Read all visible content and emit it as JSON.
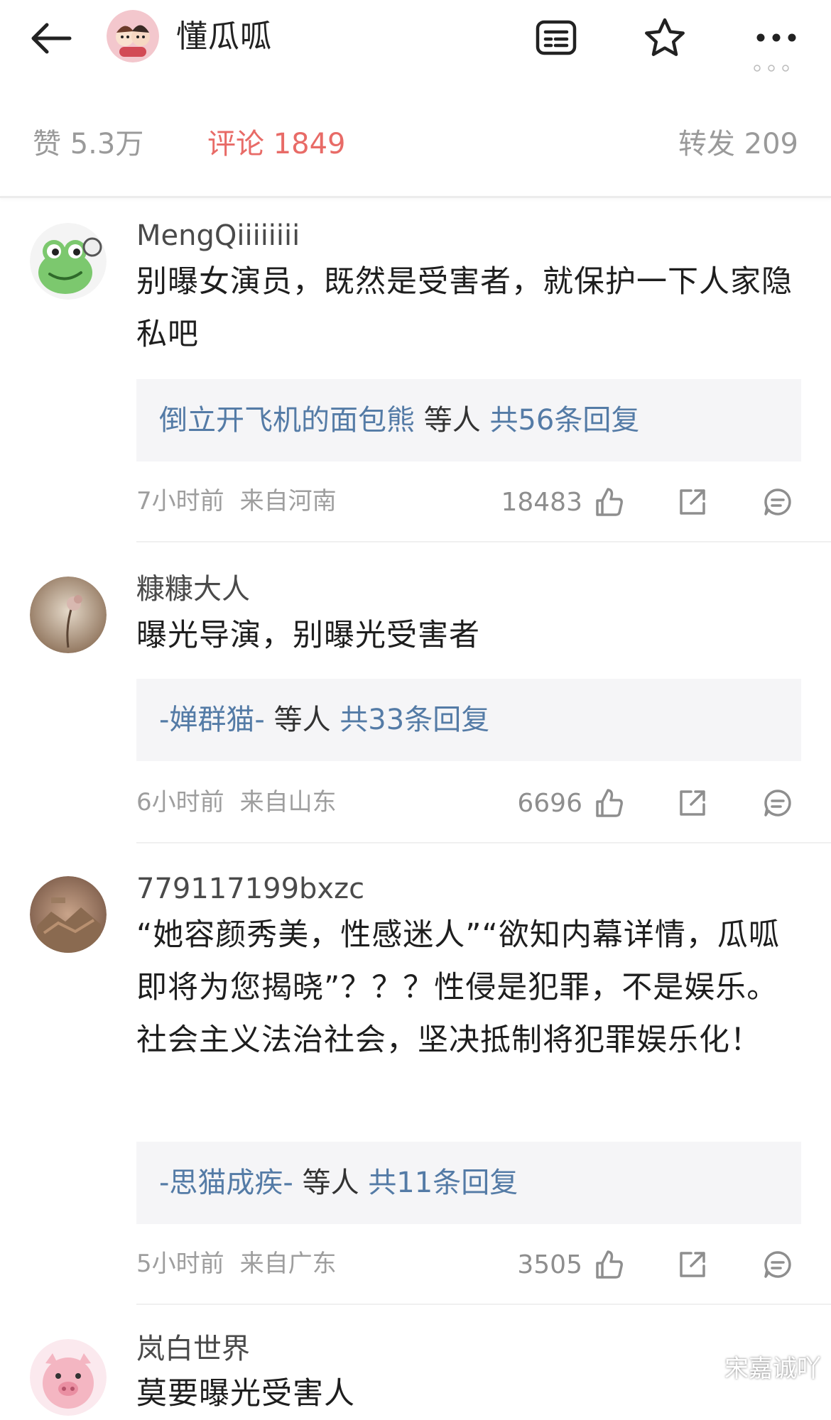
{
  "header": {
    "title": "懂瓜呱",
    "icons": [
      "back-arrow-icon",
      "article-icon",
      "star-icon",
      "more-icon"
    ]
  },
  "stats": {
    "likes": "赞 5.3万",
    "comments": "评论 1849",
    "reposts": "转发 209"
  },
  "colors": {
    "active_tab": "#e86b67",
    "reply_link": "#547ba6",
    "reply_bg": "#f5f5f7",
    "meta_gray": "#9e9e9e"
  },
  "comments": [
    {
      "user": "MengQiiiiiiii",
      "text": "别曝女演员，既然是受害者，就保护一下人家隐私吧",
      "reply_name": "倒立开飞机的面包熊",
      "reply_mid": " 等人 ",
      "reply_count": "共56条回复",
      "time": "7小时前",
      "location": "来自河南",
      "likes": "18483"
    },
    {
      "user": "糠糠大人",
      "text": "曝光导演，别曝光受害者",
      "reply_name": "-婵群猫-",
      "reply_mid": " 等人 ",
      "reply_count": "共33条回复",
      "time": "6小时前",
      "location": "来自山东",
      "likes": "6696"
    },
    {
      "user": "779117199bxzc",
      "text": "“她容颜秀美，性感迷人”“欲知内幕详情，瓜呱即将为您揭晓”？？？性侵是犯罪，不是娱乐。社会主义法治社会，坚决抵制将犯罪娱乐化！",
      "reply_name": "-思猫成疾-",
      "reply_mid": " 等人 ",
      "reply_count": "共11条回复",
      "time": "5小时前",
      "location": "来自广东",
      "likes": "3505"
    },
    {
      "user": "岚白世界",
      "text": "莫要曝光受害人"
    }
  ],
  "watermark": "宋嘉诚吖"
}
